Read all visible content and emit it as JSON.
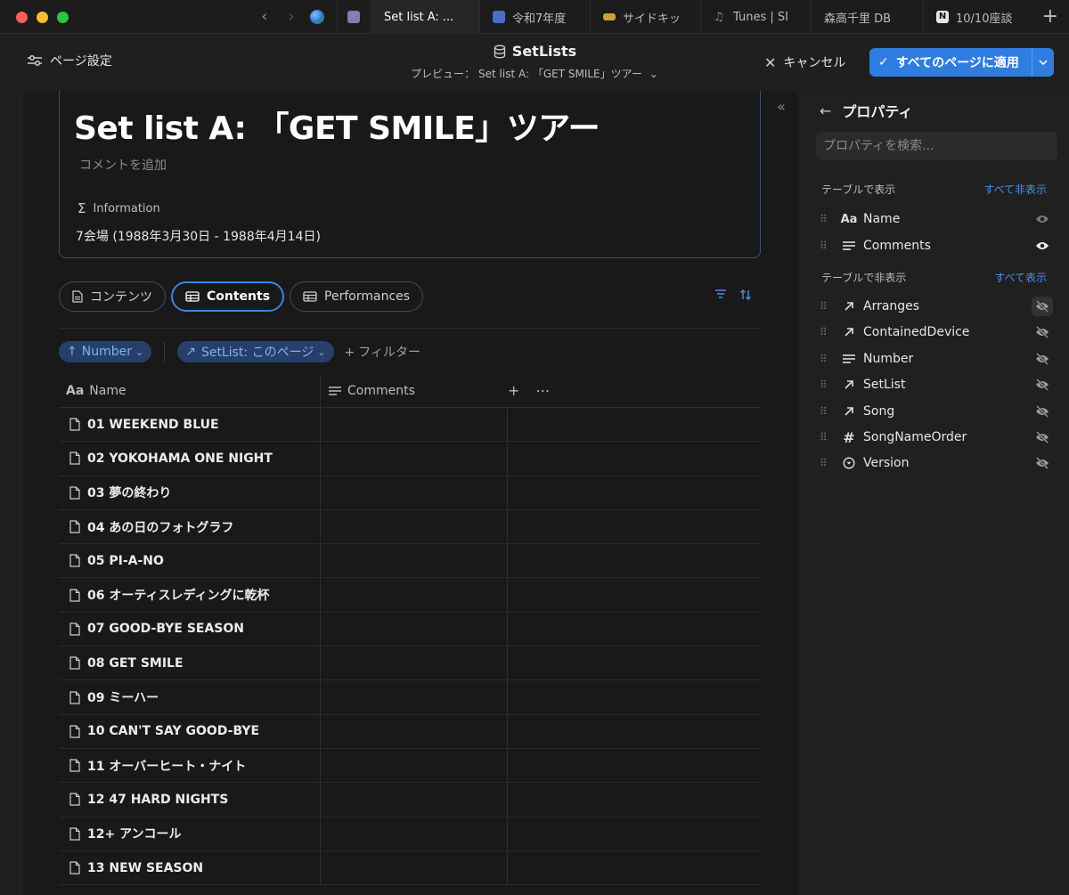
{
  "tabs": [
    {
      "label": "Set list A: ...",
      "active": true
    },
    {
      "label": "令和7年度"
    },
    {
      "label": "サイドキッ"
    },
    {
      "label": "Tunes | SI"
    },
    {
      "label": "森高千里 DB"
    },
    {
      "label": "10/10座談"
    }
  ],
  "header": {
    "page_settings": "ページ設定",
    "db_title": "SetLists",
    "preview_label": "プレビュー：",
    "preview_page": "Set list A: 「GET SMILE」ツアー",
    "cancel": "キャンセル",
    "apply_all": "すべてのページに適用"
  },
  "doc": {
    "title": "Set list A: 「GET SMILE」ツアー",
    "add_comment": "コメントを追加",
    "info_label": "Information",
    "info_value": "7会場 (1988年3月30日 - 1988年4月14日)"
  },
  "view_tabs": [
    {
      "label": "コンテンツ"
    },
    {
      "label": "Contents",
      "active": true
    },
    {
      "label": "Performances"
    }
  ],
  "filters": {
    "sort_chip": "Number",
    "filter_chip": "SetList: このページ",
    "add_filter": "フィルター"
  },
  "table": {
    "col_name": "Name",
    "col_comments": "Comments",
    "rows": [
      "01 WEEKEND BLUE",
      "02 YOKOHAMA ONE NIGHT",
      "03 夢の終わり",
      "04 あの日のフォトグラフ",
      "05 PI-A-NO",
      "06 オーティスレディングに乾杯",
      "07 GOOD-BYE SEASON",
      "08 GET SMILE",
      "09 ミーハー",
      "10 CAN'T SAY GOOD-BYE",
      "11 オーバーヒート・ナイト",
      "12 47 HARD NIGHTS",
      "12+ アンコール",
      "13 NEW SEASON"
    ]
  },
  "properties": {
    "title": "プロパティ",
    "search_placeholder": "プロパティを検索...",
    "shown_label": "テーブルで表示",
    "hide_all": "すべて非表示",
    "hidden_label": "テーブルで非表示",
    "show_all": "すべて表示",
    "shown": [
      {
        "name": "Name",
        "icon": "aa-icon",
        "visible": true
      },
      {
        "name": "Comments",
        "icon": "text-lines-icon",
        "visible": true
      }
    ],
    "hidden": [
      {
        "name": "Arranges",
        "icon": "relation-arrow-icon"
      },
      {
        "name": "ContainedDevice",
        "icon": "relation-arrow-icon"
      },
      {
        "name": "Number",
        "icon": "text-lines-icon"
      },
      {
        "name": "SetList",
        "icon": "relation-arrow-icon"
      },
      {
        "name": "Song",
        "icon": "relation-arrow-icon"
      },
      {
        "name": "SongNameOrder",
        "icon": "hash-icon"
      },
      {
        "name": "Version",
        "icon": "select-icon"
      }
    ]
  },
  "colors": {
    "accent": "#2f7de1",
    "chip_bg": "#27406a",
    "chip_text": "#7fb1f0"
  }
}
